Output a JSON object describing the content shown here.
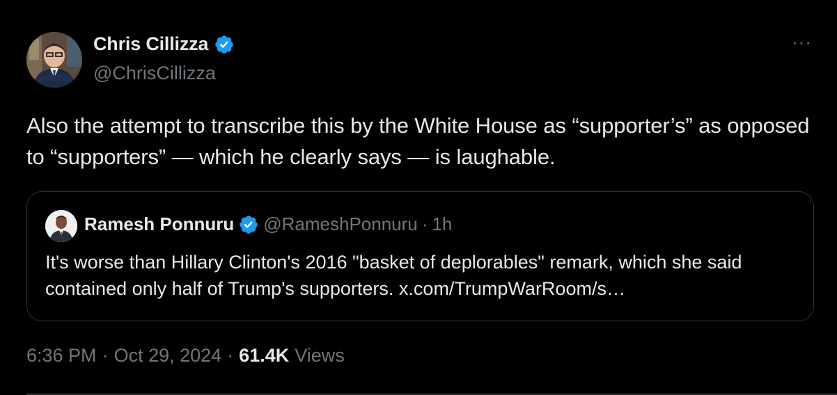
{
  "author": {
    "display_name": "Chris Cillizza",
    "handle": "@ChrisCillizza",
    "verified": true
  },
  "tweet": {
    "text": "Also the attempt to transcribe this by the White House as “supporter’s” as opposed to “supporters” — which he clearly says — is laughable."
  },
  "quote": {
    "display_name": "Ramesh Ponnuru",
    "handle": "@RameshPonnuru",
    "separator": "·",
    "time": "1h",
    "text": "It's worse than Hillary Clinton's 2016 \"basket of deplorables\" remark, which she said contained only half of Trump's supporters. x.com/TrumpWarRoom/s…"
  },
  "meta": {
    "time": "6:36 PM",
    "separator1": "·",
    "date": "Oct 29, 2024",
    "separator2": "·",
    "views_count": "61.4K",
    "views_label": "Views"
  },
  "more_menu": "···",
  "colors": {
    "background": "#000000",
    "text_primary": "#e7e9ea",
    "text_secondary": "#71767b",
    "verified_blue": "#1d9bf0",
    "border": "#2f3336"
  }
}
